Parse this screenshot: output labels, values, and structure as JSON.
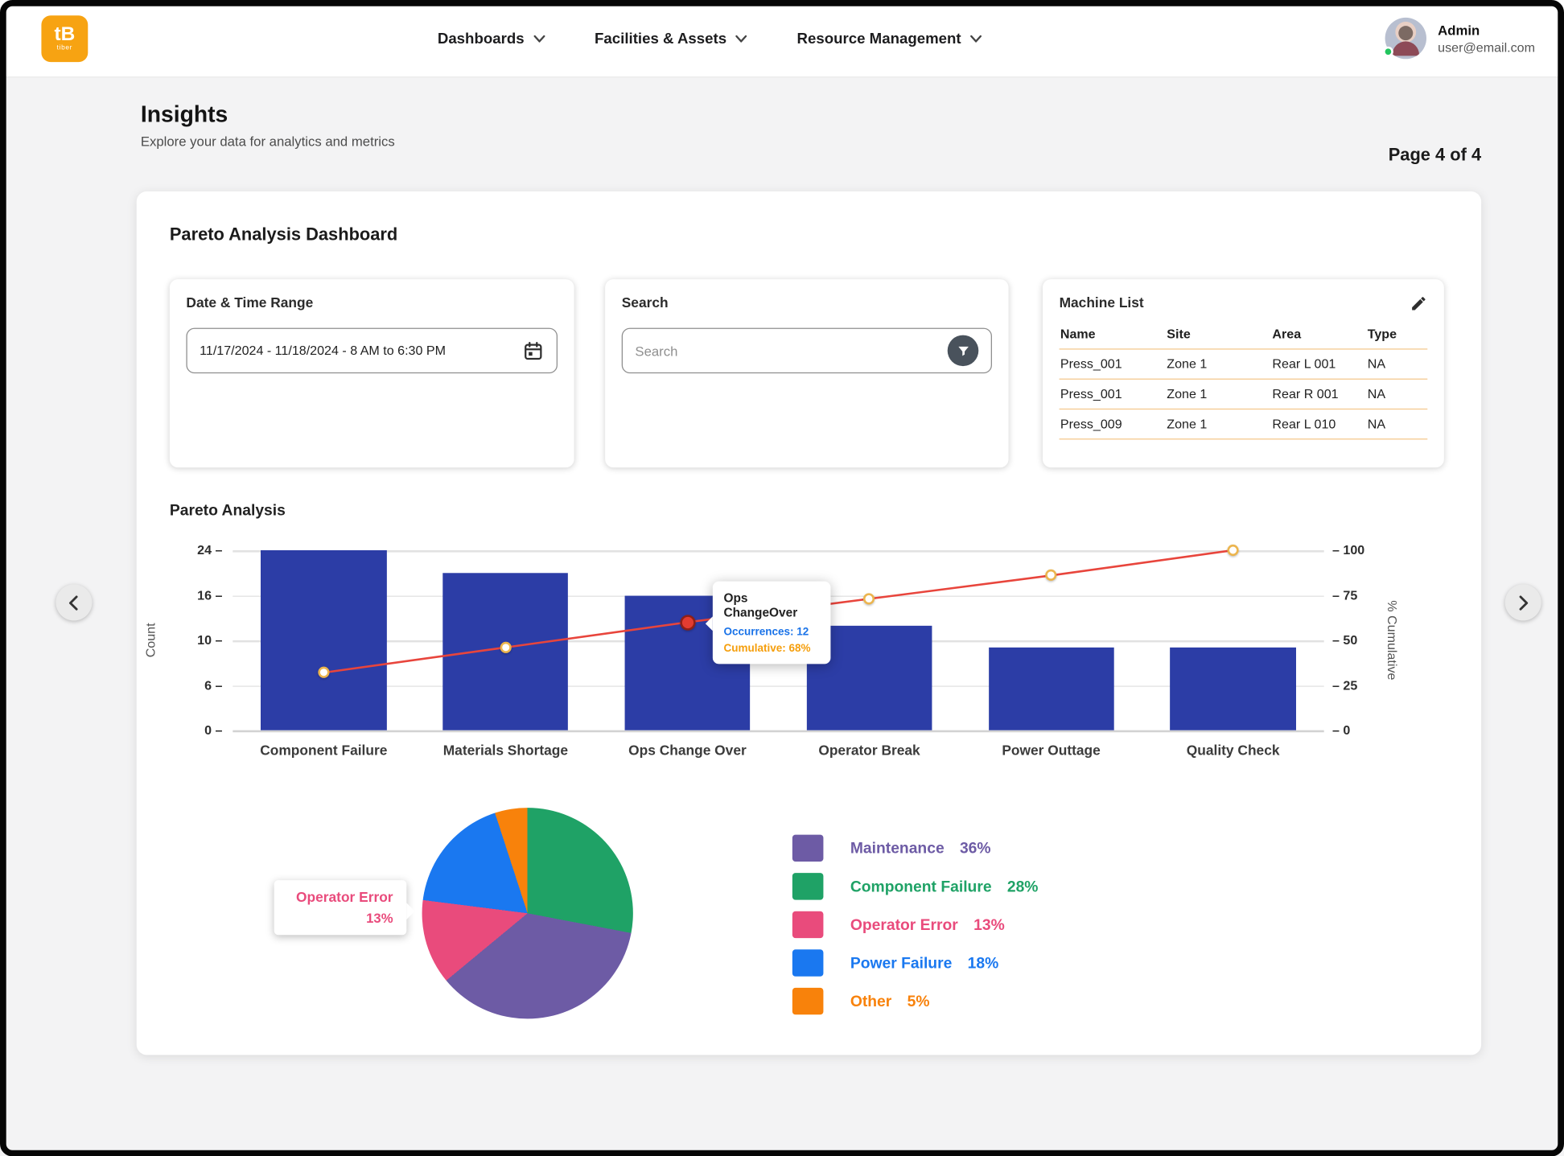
{
  "header": {
    "logo": {
      "text": "tB",
      "subtext": "tiber"
    },
    "nav": [
      {
        "label": "Dashboards"
      },
      {
        "label": "Facilities  & Assets"
      },
      {
        "label": "Resource Management"
      }
    ],
    "user": {
      "name": "Admin",
      "email": "user@email.com"
    }
  },
  "page": {
    "title": "Insights",
    "subtitle": "Explore your data for analytics and metrics",
    "pagination": "Page 4 of 4"
  },
  "dashboard": {
    "title": "Pareto Analysis Dashboard",
    "date_panel": {
      "title": "Date & Time Range",
      "value": "11/17/2024 -  11/18/2024 -  8 AM to 6:30 PM"
    },
    "search_panel": {
      "title": "Search",
      "placeholder": "Search"
    },
    "machine_list": {
      "title": "Machine List",
      "columns": [
        "Name",
        "Site",
        "Area",
        "Type"
      ],
      "rows": [
        [
          "Press_001",
          "Zone 1",
          "Rear L 001",
          "NA"
        ],
        [
          "Press_001",
          "Zone 1",
          "Rear R 001",
          "NA"
        ],
        [
          "Press_009",
          "Zone 1",
          "Rear L 010",
          "NA"
        ]
      ]
    },
    "section_title": "Pareto Analysis"
  },
  "tooltip": {
    "title": "Ops ChangeOver",
    "line1": "Occurrences: 12",
    "line2": "Cumulative: 68%"
  },
  "chart_data": [
    {
      "type": "bar",
      "title": "Pareto Analysis",
      "categories": [
        "Component Failure",
        "Materials Shortage",
        "Ops Change Over",
        "Operator Break",
        "Power Outtage",
        "Quality Check"
      ],
      "series": [
        {
          "name": "Count",
          "type": "bar",
          "values": [
            24,
            21,
            18,
            14,
            11,
            11
          ],
          "color": "#2c3da6"
        },
        {
          "name": "% Cumulative",
          "type": "line",
          "values": [
            32,
            46,
            60,
            73,
            86,
            100
          ],
          "color": "#e8453c"
        }
      ],
      "ylabel": "Count",
      "y2label": "% Cumulative",
      "yticks": [
        0,
        6,
        10,
        16,
        24
      ],
      "y2ticks": [
        0,
        25,
        50,
        75,
        100
      ],
      "ylim": [
        0,
        24
      ],
      "y2lim": [
        0,
        100
      ],
      "grid": true,
      "highlight_index": 2,
      "highlight_tooltip": {
        "title": "Ops ChangeOver",
        "occurrences": 12,
        "cumulative_pct": 68
      }
    },
    {
      "type": "pie",
      "labels": [
        "Maintenance",
        "Component Failure",
        "Operator Error",
        "Power Failure",
        "Other"
      ],
      "values": [
        36,
        28,
        13,
        18,
        5
      ],
      "colors": [
        "#6d5ba5",
        "#1fa266",
        "#e94b7c",
        "#1a78f0",
        "#f8820b"
      ],
      "clockwise_order": [
        "Component Failure",
        "Maintenance",
        "Operator Error",
        "Power Failure",
        "Other"
      ],
      "legend_position": "right",
      "callout": {
        "label": "Operator Error",
        "value": "13%"
      }
    }
  ]
}
